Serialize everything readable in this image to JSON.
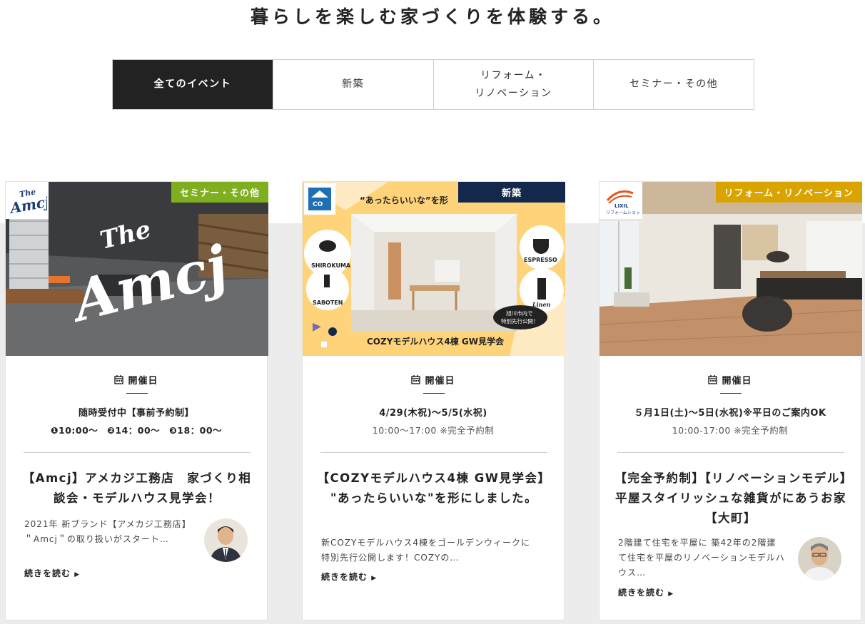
{
  "page_title": "暮らしを楽しむ家づくりを体験する。",
  "tabs": [
    {
      "label": "全てのイベント",
      "active": true
    },
    {
      "label": "新築"
    },
    {
      "label": "リフォーム・\nリノベーション"
    },
    {
      "label": "セミナー・その他"
    }
  ],
  "date_heading": "開催日",
  "read_more": "続きを読む",
  "cards": [
    {
      "category": "セミナー・その他",
      "category_color": "#7fae1e",
      "logo_text": "The Amcj",
      "hero_text": "The Amcj",
      "date_main": "随時受付中【事前予約制】",
      "date_sub": "❶10:00～　❷14：00～　❸18：00～",
      "title": "【Amcj】アメカジ工務店　家づくり相談会・モデルハウス見学会！",
      "description": "2021年 新ブランド【アメカジ工務店】　＂Amcj＂の取り扱いがスタート…"
    },
    {
      "category": "新築",
      "category_color": "#14284b",
      "logo_text": "COZY",
      "banner_top": "“あったらいいな”を形",
      "icons": [
        "SHIROKUMA",
        "SABOTEN",
        "ESPRESSO",
        "Linen"
      ],
      "bubble_text": "旭川市内で\n特別先行公開！",
      "banner_bottom": "COZYモデルハウス4棟 GW見学会",
      "date_main": "4/29(木祝)～5/5(水祝)",
      "date_sub": "10:00～17:00 ※完全予約制",
      "title": "【COZYモデルハウス4棟 GW見学会】 \"あったらいいな\"を形にしました。",
      "description": "新COZYモデルハウス4棟をゴールデンウィークに特別先行公開します！COZYの…"
    },
    {
      "category": "リフォーム・リノベーション",
      "category_color": "#d9a400",
      "logo_text": "LIXIL リフォームショップ",
      "date_main": "５月1日(土)～5日(水祝)※平日のご案内OK",
      "date_sub": "10:00-17:00 ※完全予約制",
      "title": "【完全予約制】【リノベーションモデル】平屋スタイリッシュな雑貨がにあうお家【大町】",
      "description": "2階建て住宅を平屋に 築42年の2階建て住宅を平屋のリノベーションモデルハウス…"
    }
  ]
}
